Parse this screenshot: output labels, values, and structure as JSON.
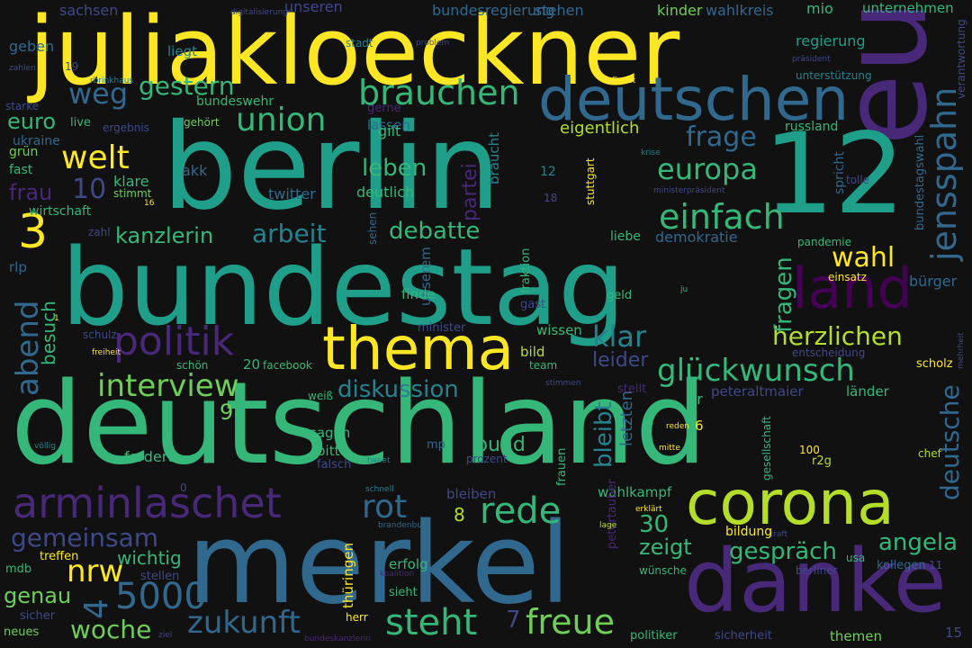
{
  "palette": {
    "background": "#111111",
    "yellow": "#fde725",
    "lime": "#b5de2b",
    "green": "#6ece58",
    "sea": "#35b779",
    "teal": "#1f9e89",
    "cyan": "#26828e",
    "blue": "#31688e",
    "indigo": "#3e4989",
    "purple": "#482878",
    "violet": "#440154"
  },
  "words": [
    "juliakloeckner",
    "berlin",
    "bundestag",
    "deutschland",
    "merkel",
    "eu",
    "12",
    "danke",
    "corona",
    "deutschen",
    "land",
    "thema",
    "arminlaschet",
    "politik",
    "brauchen",
    "union",
    "jensspahn",
    "europa",
    "einfach",
    "welt",
    "weg",
    "gestern",
    "frage",
    "zukunft",
    "steht",
    "freue",
    "rede",
    "rot",
    "glückwunsch",
    "herzlichen",
    "interview",
    "diskussion",
    "klar",
    "kanzlerin",
    "arbeit",
    "debatte",
    "leben",
    "wahl",
    "nrw",
    "gemeinsam",
    "woche",
    "angela",
    "gespräch",
    "zeigt",
    "abend",
    "deutsche",
    "fragen",
    "bleibt",
    "3",
    "10",
    "5000",
    "4",
    "7",
    "30",
    "9",
    "8",
    "frau",
    "euro",
    "partei",
    "leider",
    "besuch",
    "genau",
    "wichtig",
    "bund",
    "letzten",
    "demokratie",
    "bürger",
    "regierung",
    "unterstützung",
    "bundesregierung",
    "wahlkreis",
    "mio",
    "unternehmen",
    "kinder",
    "stehen",
    "sachsen",
    "unseren",
    "digitalisierung",
    "geben",
    "liegt",
    "stadt",
    "problem",
    "zahlen",
    "präsident",
    "starke",
    "rbrinkhaus",
    "findet",
    "verantwortung",
    "ergebnis",
    "gerne",
    "live",
    "gehört",
    "bundeswehr",
    "lassen",
    "russland",
    "ukraine",
    "gilt",
    "eigentlich",
    "krise",
    "grün",
    "fast",
    "akk",
    "klare",
    "stimmt",
    "twitter",
    "deutlich",
    "braucht",
    "stuttgart",
    "ministerpräsident",
    "tolle",
    "spricht",
    "bundestagswahl",
    "wirtschaft",
    "zahl",
    "sehen",
    "unserem",
    "liebe",
    "pandemie",
    "rlp",
    "fraktion",
    "geld",
    "finde",
    "gast",
    "einsatz",
    "ju",
    "minister",
    "wissen",
    "bild",
    "schulz",
    "freiheit",
    "schön",
    "facebook",
    "team",
    "entscheidung",
    "scholz",
    "mehrheit",
    "weiß",
    "stimmen",
    "stellt",
    "dr",
    "peteraltmaier",
    "länder",
    "reden",
    "mitte",
    "völlig",
    "mp",
    "sagen",
    "bitte",
    "fordert",
    "falsch",
    "tweet",
    "prozent",
    "frauen",
    "gesellschaft",
    "r2g",
    "chef",
    "schnell",
    "bleiben",
    "wahlkampf",
    "petertauber",
    "erklärt",
    "lage",
    "brandenburg",
    "treffen",
    "mdb",
    "stellen",
    "koalition",
    "erfolg",
    "thüringen",
    "sieht",
    "kraft",
    "usa",
    "wünsche",
    "berliner",
    "kollegen",
    "sicher",
    "herr",
    "neues",
    "ziel",
    "bundeskanzlerin",
    "politiker",
    "sicherheit",
    "themen",
    "bildung",
    "1",
    "0",
    "6",
    "100",
    "11",
    "15",
    "16",
    "18",
    "19",
    "20",
    "12"
  ]
}
